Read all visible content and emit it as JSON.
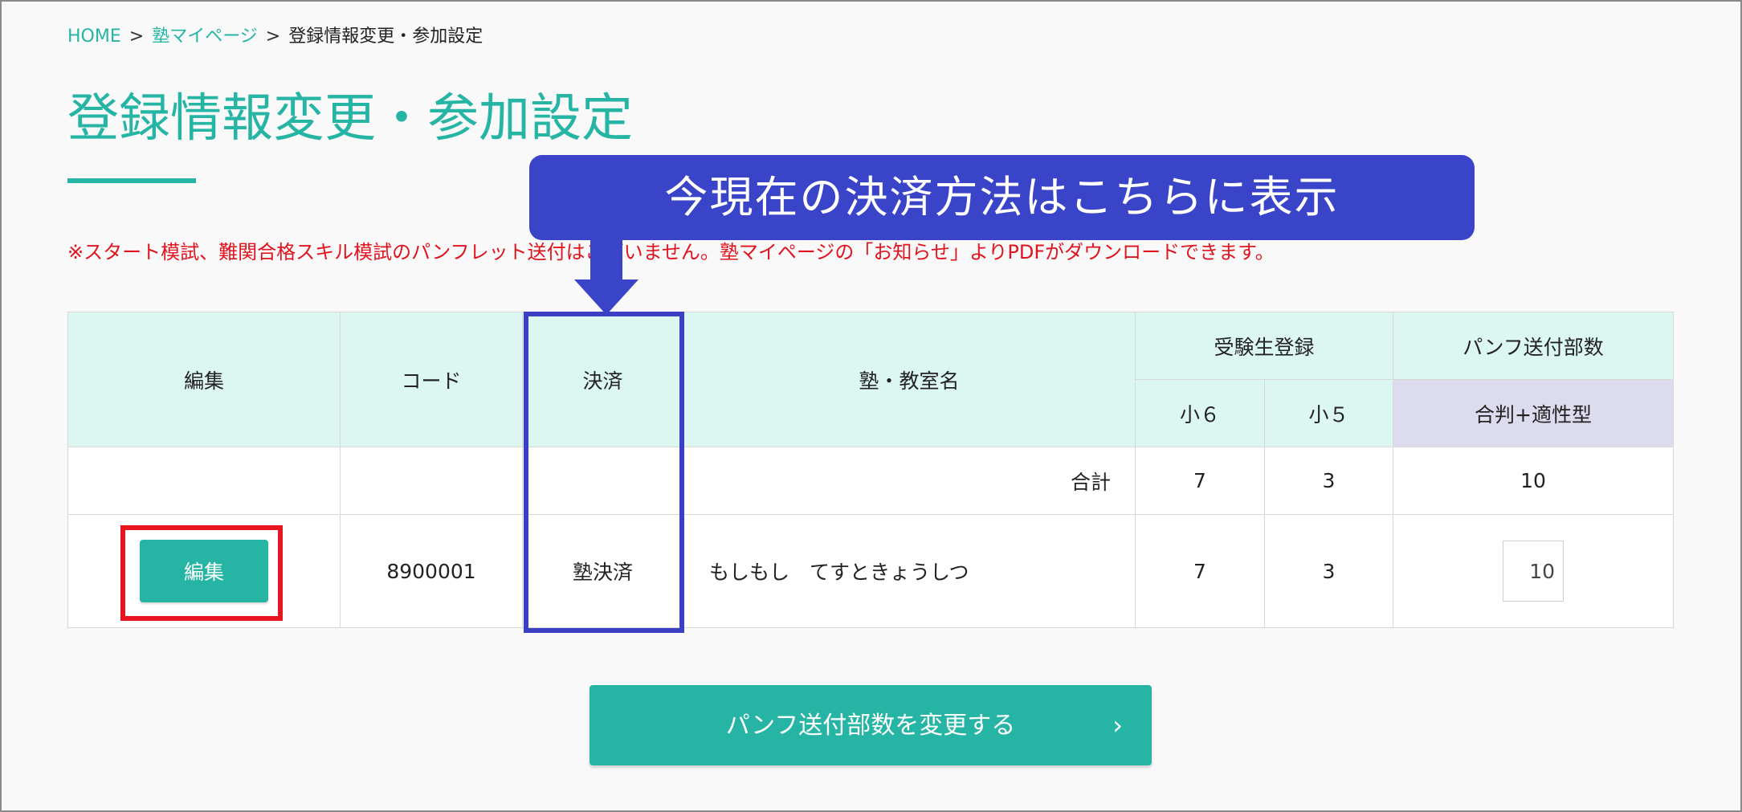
{
  "breadcrumb": {
    "home": "HOME",
    "sep1": ">",
    "mypage": "塾マイページ",
    "sep2": ">",
    "current": "登録情報変更・参加設定"
  },
  "page_title": "登録情報変更・参加設定",
  "notice": "※スタート模試、難関合格スキル模試のパンフレット送付はございません。塾マイページの「お知らせ」よりPDFがダウンロードできます。",
  "callout": {
    "text": "今現在の決済方法はこちらに表示"
  },
  "table": {
    "headers": {
      "edit": "編集",
      "code": "コード",
      "payment": "決済",
      "school": "塾・教室名",
      "exam_registration": "受験生登録",
      "grade6": "小６",
      "grade5": "小５",
      "pamphlet_count": "パンフ送付部数",
      "pamphlet_type": "合判+適性型"
    },
    "total_row": {
      "label": "合計",
      "grade6": "7",
      "grade5": "3",
      "pamphlet": "10"
    },
    "rows": [
      {
        "edit_label": "編集",
        "code": "8900001",
        "payment": "塾決済",
        "school": "もしもし　てすときょうしつ",
        "grade6": "7",
        "grade5": "3",
        "pamphlet": "10"
      }
    ]
  },
  "submit": {
    "label": "パンフ送付部数を変更する",
    "chevron": "›"
  },
  "colors": {
    "accent": "#26b5a5",
    "notice": "#e0141e",
    "callout": "#3a44c8",
    "highlight_red": "#e8141f",
    "highlight_blue": "#3a3fc4"
  }
}
